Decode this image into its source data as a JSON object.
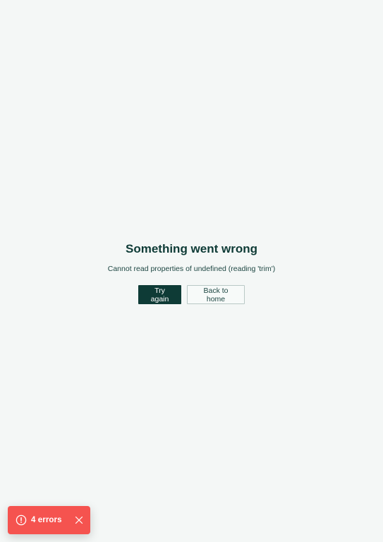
{
  "error": {
    "title": "Something went wrong",
    "message": "Cannot read properties of undefined (reading 'trim')",
    "retry_label": "Try again",
    "home_label": "Back to home"
  },
  "toast": {
    "label": "4 errors",
    "icon": "alert-circle-icon",
    "close_icon": "close-icon"
  },
  "colors": {
    "background": "#f4f7f6",
    "primary": "#0e3b36",
    "toast": "#f5534f"
  }
}
